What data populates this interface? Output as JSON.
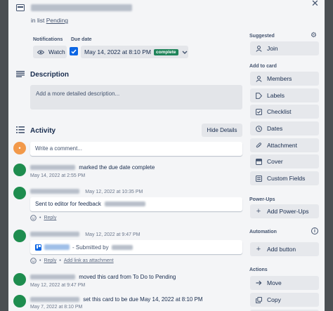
{
  "card": {
    "list_prefix": "in list",
    "list_name": "Pending"
  },
  "header": {
    "notifications_label": "Notifications",
    "watch_label": "Watch",
    "due_date_label": "Due date",
    "due_value": "May 14, 2022 at 8:10 PM",
    "due_status": "complete"
  },
  "description": {
    "title": "Description",
    "placeholder": "Add a more detailed description..."
  },
  "activity": {
    "title": "Activity",
    "hide_details": "Hide Details",
    "comment_placeholder": "Write a comment...",
    "items": [
      {
        "text": "marked the due date complete",
        "time": "May 14, 2022 at 2:55 PM"
      },
      {
        "time": "May 12, 2022 at 10:35 PM",
        "comment": "Sent to editor for feedback",
        "reply": "Reply"
      },
      {
        "time": "May 12, 2022 at 9:47 PM",
        "attachment_suffix": "- Submitted by",
        "reply": "Reply",
        "add_link": "Add link as attachment"
      },
      {
        "text": "moved this card from To Do to Pending",
        "time": "May 12, 2022 at 9:47 PM"
      },
      {
        "text": "set this card to be due May 14, 2022 at 8:10 PM",
        "time": "May 7, 2022 at 8:10 PM"
      }
    ]
  },
  "sidebar": {
    "suggested": "Suggested",
    "join": "Join",
    "add_to_card": "Add to card",
    "members": "Members",
    "labels": "Labels",
    "checklist": "Checklist",
    "dates": "Dates",
    "attachment": "Attachment",
    "cover": "Cover",
    "custom_fields": "Custom Fields",
    "power_ups": "Power-Ups",
    "add_power_ups": "Add Power-Ups",
    "automation": "Automation",
    "add_button": "Add button",
    "actions": "Actions",
    "move": "Move",
    "copy": "Copy"
  },
  "colors": {
    "accent": "#0c66e4",
    "complete_badge": "#1f845a",
    "avatar": "#1e8d4f",
    "user_avatar": "#f2994a"
  },
  "icons": [
    "card-icon",
    "close-icon",
    "eye-icon",
    "checkbox-icon",
    "chevron-down-icon",
    "description-icon",
    "activity-icon",
    "gear-icon",
    "user-icon",
    "label-icon",
    "checklist-icon",
    "clock-icon",
    "paperclip-icon",
    "cover-icon",
    "custom-fields-icon",
    "plus-icon",
    "info-icon",
    "arrow-right-icon",
    "copy-icon",
    "emoji-icon",
    "trello-icon"
  ]
}
